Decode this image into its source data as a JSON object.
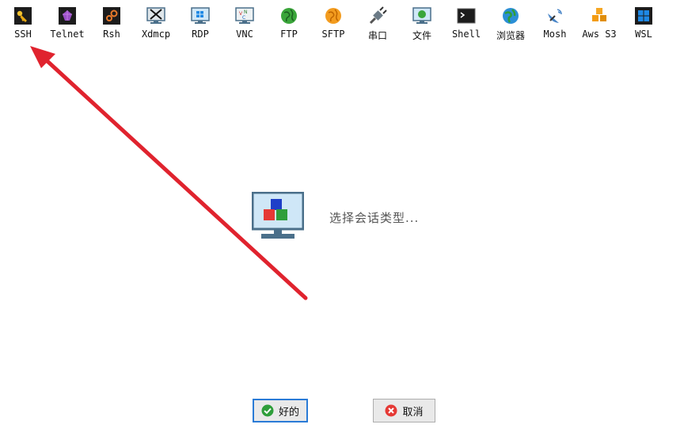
{
  "toolbar": {
    "items": [
      {
        "label": "SSH",
        "icon": "key-icon"
      },
      {
        "label": "Telnet",
        "icon": "telnet-icon"
      },
      {
        "label": "Rsh",
        "icon": "rsh-icon"
      },
      {
        "label": "Xdmcp",
        "icon": "xdmcp-icon"
      },
      {
        "label": "RDP",
        "icon": "rdp-monitor-icon"
      },
      {
        "label": "VNC",
        "icon": "vnc-icon"
      },
      {
        "label": "FTP",
        "icon": "ftp-globe-icon"
      },
      {
        "label": "SFTP",
        "icon": "sftp-globe-icon"
      },
      {
        "label": "串口",
        "icon": "serial-plug-icon"
      },
      {
        "label": "文件",
        "icon": "file-monitor-icon"
      },
      {
        "label": "Shell",
        "icon": "terminal-icon"
      },
      {
        "label": "浏览器",
        "icon": "browser-globe-icon"
      },
      {
        "label": "Mosh",
        "icon": "satellite-icon"
      },
      {
        "label": "Aws S3",
        "icon": "aws-cubes-icon"
      },
      {
        "label": "WSL",
        "icon": "windows-icon"
      }
    ]
  },
  "main": {
    "prompt": "选择会话类型..."
  },
  "buttons": {
    "ok_label": "好的",
    "cancel_label": "取消"
  },
  "colors": {
    "arrow": "#e0232e",
    "ok_border": "#2a7bd6",
    "monitor_blue": "#4a6f8a"
  }
}
